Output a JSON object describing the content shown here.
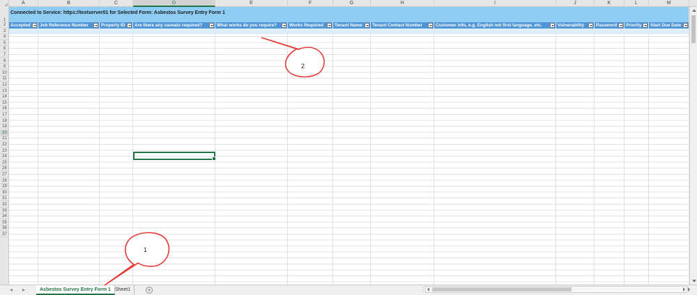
{
  "columns": [
    "A",
    "B",
    "C",
    "D",
    "E",
    "F",
    "G",
    "H",
    "I",
    "J",
    "K",
    "L",
    "M"
  ],
  "selected_column": "D",
  "banner_text": "Connected to Service: https://testserver01 for Selected Form: Asbestos Survey Entry Form 1",
  "header_cells": [
    "Accepted",
    "Job Reference Number",
    "Property ID",
    "Are there any caveats required?",
    "What works do you require?",
    "Works Required",
    "Tenant Name",
    "Tenant Contact Number",
    "Customer info, e.g. English not first language, etc.",
    "Vulnerability",
    "Password",
    "Priority",
    "Start Due Date"
  ],
  "rows": [
    "1",
    "2",
    "3",
    "4",
    "5",
    "6",
    "7",
    "8",
    "9",
    "10",
    "11",
    "12",
    "13",
    "14",
    "15",
    "16",
    "17",
    "18",
    "19",
    "20",
    "21",
    "22",
    "23",
    "24",
    "25",
    "26",
    "27",
    "28",
    "29",
    "30",
    "31",
    "32",
    "33",
    "34",
    "35",
    "36",
    "37"
  ],
  "selected_row": "20",
  "sheet_tabs": [
    "Asbestos Survey Entry Form 1",
    "Sheet1"
  ],
  "active_tab": "Asbestos Survey Entry Form 1",
  "tab_nav": {
    "prev": "◂",
    "next": "▸",
    "add": "+",
    "more": "⋮"
  },
  "callouts": [
    "1",
    "2"
  ],
  "colors": {
    "banner": "#8fcdf5",
    "header_cell": "#4f94d6",
    "accent": "#217346",
    "callout": "#e53935"
  }
}
